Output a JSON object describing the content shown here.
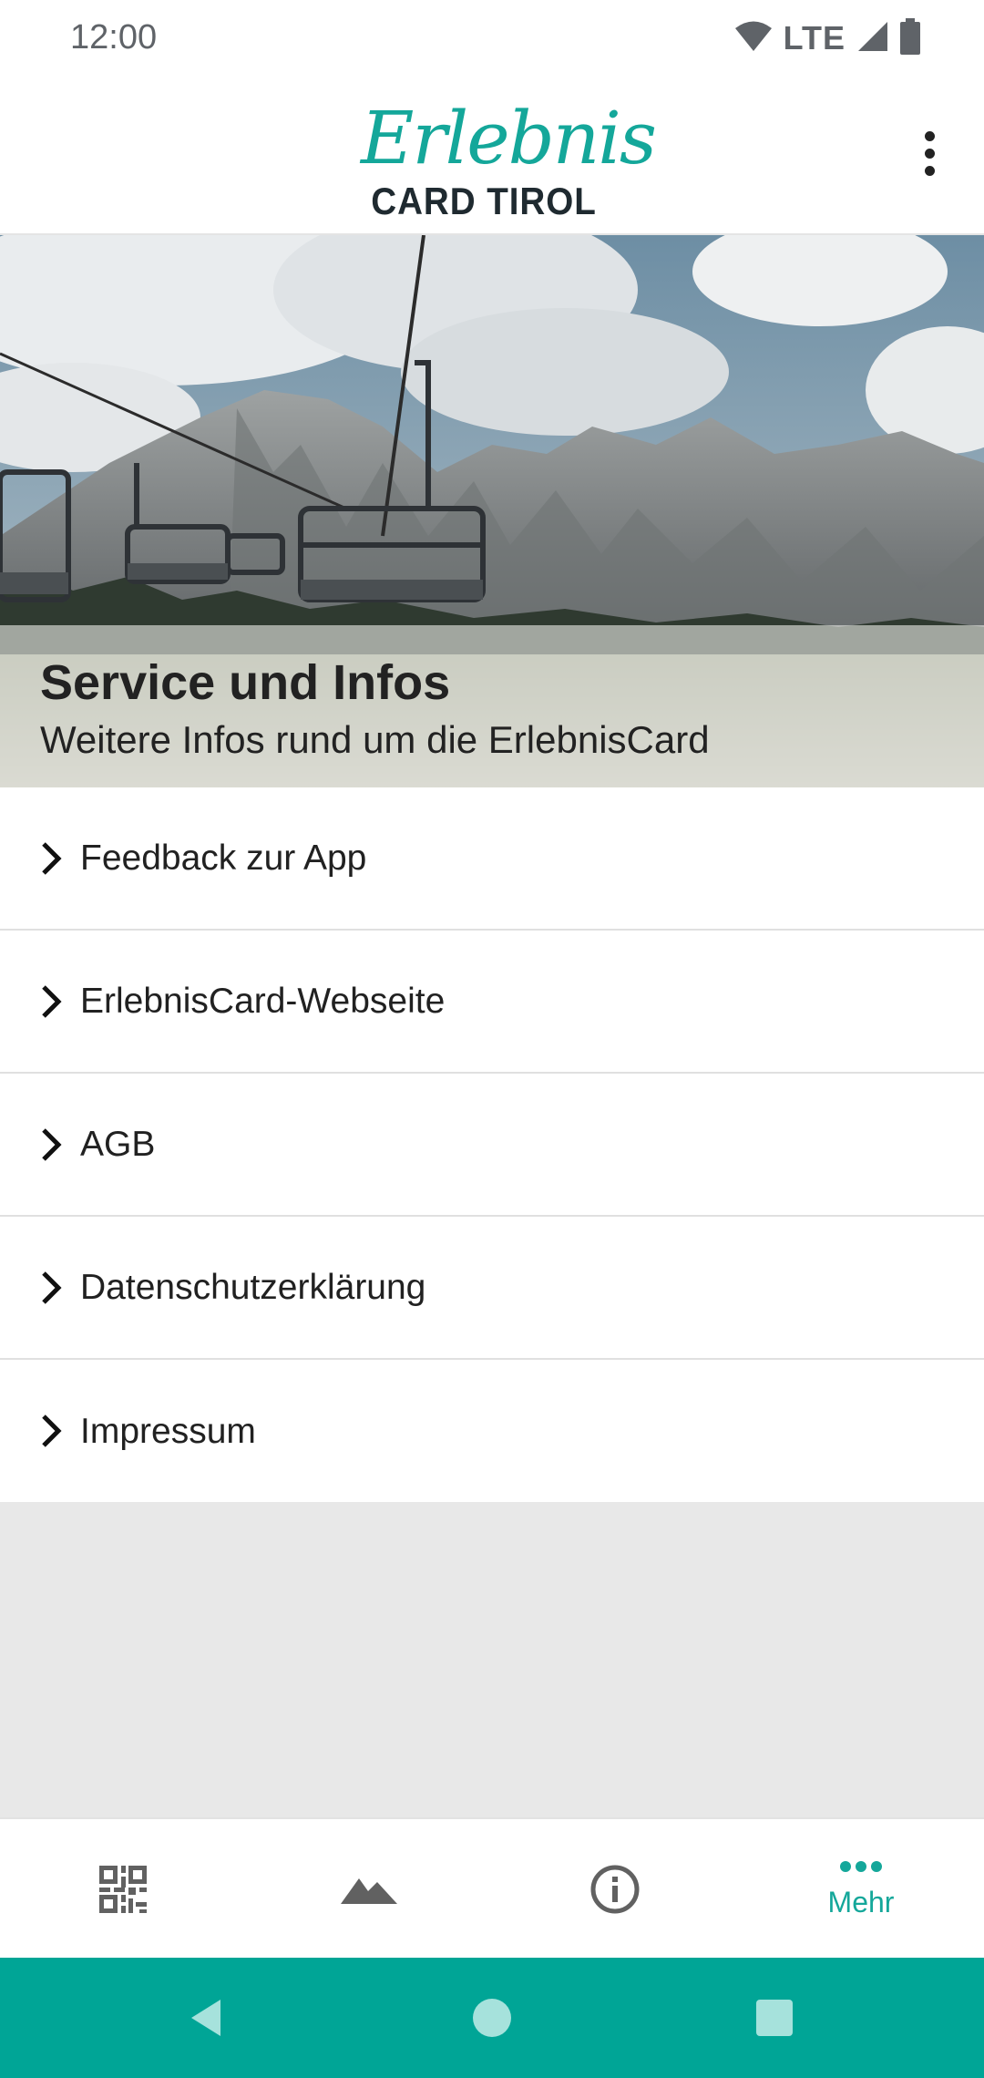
{
  "status_bar": {
    "time": "12:00",
    "network": "LTE",
    "icons": [
      "wifi-icon",
      "cell-signal-icon",
      "battery-icon"
    ]
  },
  "app_bar": {
    "logo_script": "Erlebnis",
    "logo_sub": "CARD TIROL",
    "overflow_icon": "more-vert-icon"
  },
  "hero": {
    "title": "Service und Infos",
    "subtitle": "Weitere Infos rund um die ErlebnisCard"
  },
  "menu": {
    "items": [
      {
        "label": "Feedback zur App"
      },
      {
        "label": "ErlebnisCard-Webseite"
      },
      {
        "label": "AGB"
      },
      {
        "label": "Datenschutzerklärung"
      },
      {
        "label": "Impressum"
      }
    ]
  },
  "bottom_nav": {
    "items": [
      {
        "icon": "qr-code-icon",
        "label": ""
      },
      {
        "icon": "mountain-icon",
        "label": ""
      },
      {
        "icon": "info-icon",
        "label": ""
      },
      {
        "icon": "more-horiz-icon",
        "label": "Mehr",
        "active": true
      }
    ]
  },
  "system_nav": {
    "icons": [
      "back-icon",
      "home-icon",
      "recents-icon"
    ]
  },
  "colors": {
    "accent": "#14a79a",
    "system_nav_bg": "#00a596",
    "empty_bg": "#e8e8e8"
  }
}
